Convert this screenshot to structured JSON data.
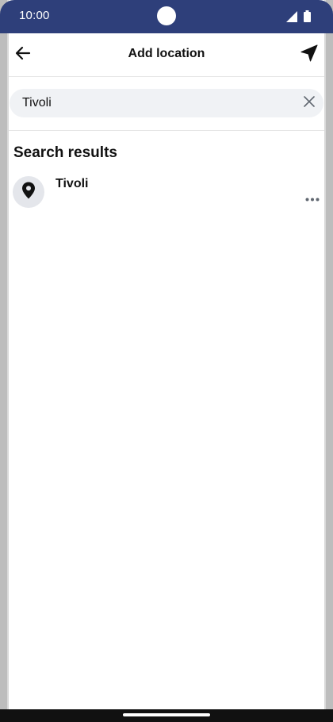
{
  "status_bar": {
    "time": "10:00",
    "background_color": "#2e3f7a"
  },
  "header": {
    "title": "Add location",
    "back_icon": "back-arrow-icon",
    "locate_icon": "navigation-arrow-icon"
  },
  "search": {
    "value": "Tivoli",
    "clear_icon": "close-icon"
  },
  "results": {
    "title": "Search results",
    "items": [
      {
        "name": "Tivoli",
        "icon": "location-pin-icon",
        "more_icon": "more-horizontal-icon"
      }
    ]
  }
}
